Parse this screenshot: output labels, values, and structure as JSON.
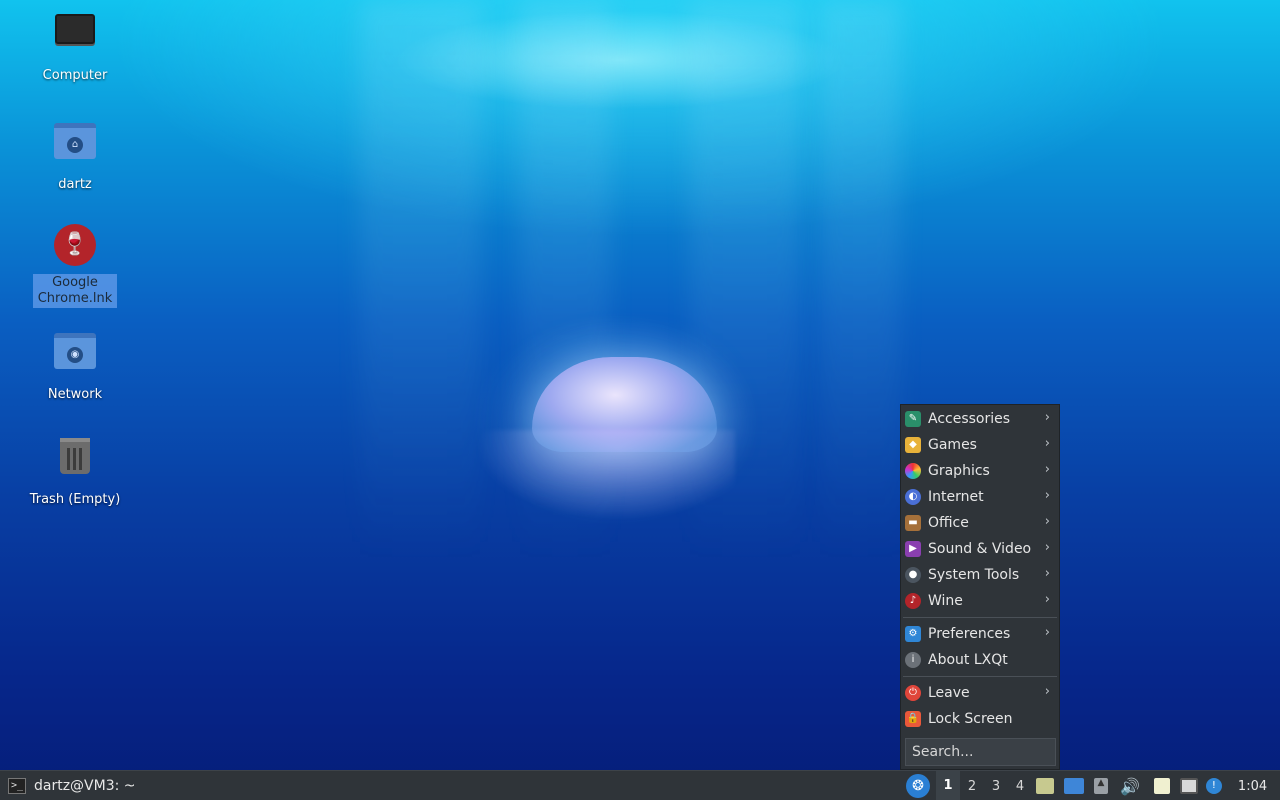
{
  "desktop": {
    "icons": [
      {
        "label": "Computer",
        "icon": "computer-icon"
      },
      {
        "label": "dartz",
        "icon": "home-folder-icon"
      },
      {
        "label": "Google\nChrome.lnk",
        "icon": "wine-icon",
        "selected": true
      },
      {
        "label": "Network",
        "icon": "network-folder-icon"
      },
      {
        "label": "Trash (Empty)",
        "icon": "trash-icon"
      }
    ]
  },
  "menu": {
    "items": [
      {
        "label": "Accessories",
        "icon": "accessories-icon",
        "submenu": true
      },
      {
        "label": "Games",
        "icon": "games-icon",
        "submenu": true
      },
      {
        "label": "Graphics",
        "icon": "graphics-icon",
        "submenu": true
      },
      {
        "label": "Internet",
        "icon": "internet-icon",
        "submenu": true
      },
      {
        "label": "Office",
        "icon": "office-icon",
        "submenu": true
      },
      {
        "label": "Sound & Video",
        "icon": "sound-video-icon",
        "submenu": true
      },
      {
        "label": "System Tools",
        "icon": "system-tools-icon",
        "submenu": true
      },
      {
        "label": "Wine",
        "icon": "wine-icon",
        "submenu": true
      }
    ],
    "items2": [
      {
        "label": "Preferences",
        "icon": "preferences-icon",
        "submenu": true
      },
      {
        "label": "About LXQt",
        "icon": "info-icon",
        "submenu": false
      }
    ],
    "items3": [
      {
        "label": "Leave",
        "icon": "power-icon",
        "submenu": true
      },
      {
        "label": "Lock Screen",
        "icon": "lock-icon",
        "submenu": false
      }
    ],
    "search_placeholder": "Search..."
  },
  "taskbar": {
    "task_label": "dartz@VM3: ~",
    "workspaces": [
      "1",
      "2",
      "3",
      "4"
    ],
    "active_workspace": "1",
    "clock": "1:04"
  },
  "colors": {
    "panel": "#2f3439",
    "accent": "#5b95dc"
  }
}
